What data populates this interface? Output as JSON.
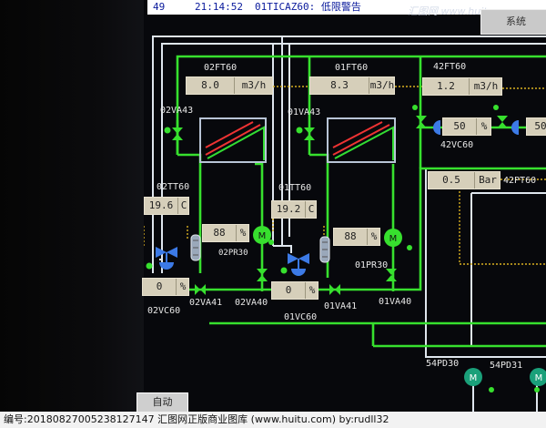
{
  "alarm_bar": {
    "number": "49",
    "time": "21:14:52",
    "message": "01TICAZ60: 低限警告"
  },
  "watermark": "汇图网 www.huitu.com",
  "system_button": "系统",
  "auto_button": "自动",
  "footer": "编号:20180827005238127147 汇图网正版商业图库 (www.huitu.com) by:rudll32",
  "colors": {
    "pipe_green": "#37e02e",
    "pipe_white": "#dfe6ee",
    "dotted_yellow": "#d8b020",
    "readout_bg": "#d6cfba"
  },
  "flows": {
    "f02": {
      "tag": "02FT60",
      "value": "8.0",
      "unit": "m3/h"
    },
    "f01": {
      "tag": "01FT60",
      "value": "8.3",
      "unit": "m3/h"
    },
    "f42": {
      "tag": "42FT60",
      "value": "1.2",
      "unit": "m3/h"
    }
  },
  "temps": {
    "t02": {
      "tag": "02TT60",
      "value": "19.6",
      "unit": "C"
    },
    "t01": {
      "tag": "01TT60",
      "value": "19.2",
      "unit": "C"
    }
  },
  "controllers": {
    "pr02": {
      "tag": "02PR30",
      "value": "88",
      "unit": "%"
    },
    "pr01": {
      "tag": "01PR30",
      "value": "88",
      "unit": "%"
    },
    "vc02": {
      "tag": "02VC60",
      "value": "0",
      "unit": "%"
    },
    "vc01": {
      "tag": "01VC60",
      "value": "0",
      "unit": "%"
    },
    "vc42": {
      "tag": "42VC60",
      "value": "50",
      "unit": "%"
    },
    "vc42b": {
      "value": "50"
    }
  },
  "pressure": {
    "tag": "42PT60",
    "value": "0.5",
    "unit": "Bar"
  },
  "valves": {
    "v02va43": "02VA43",
    "v01va43": "01VA43",
    "v02va41": "02VA41",
    "v02va40": "02VA40",
    "v01va41": "01VA41",
    "v01va40": "01VA40",
    "v01vc60_label": "01VC60"
  },
  "pumps": {
    "p54pd30": "54PD30",
    "p54pd31": "54PD31"
  },
  "motor_glyph": "M"
}
